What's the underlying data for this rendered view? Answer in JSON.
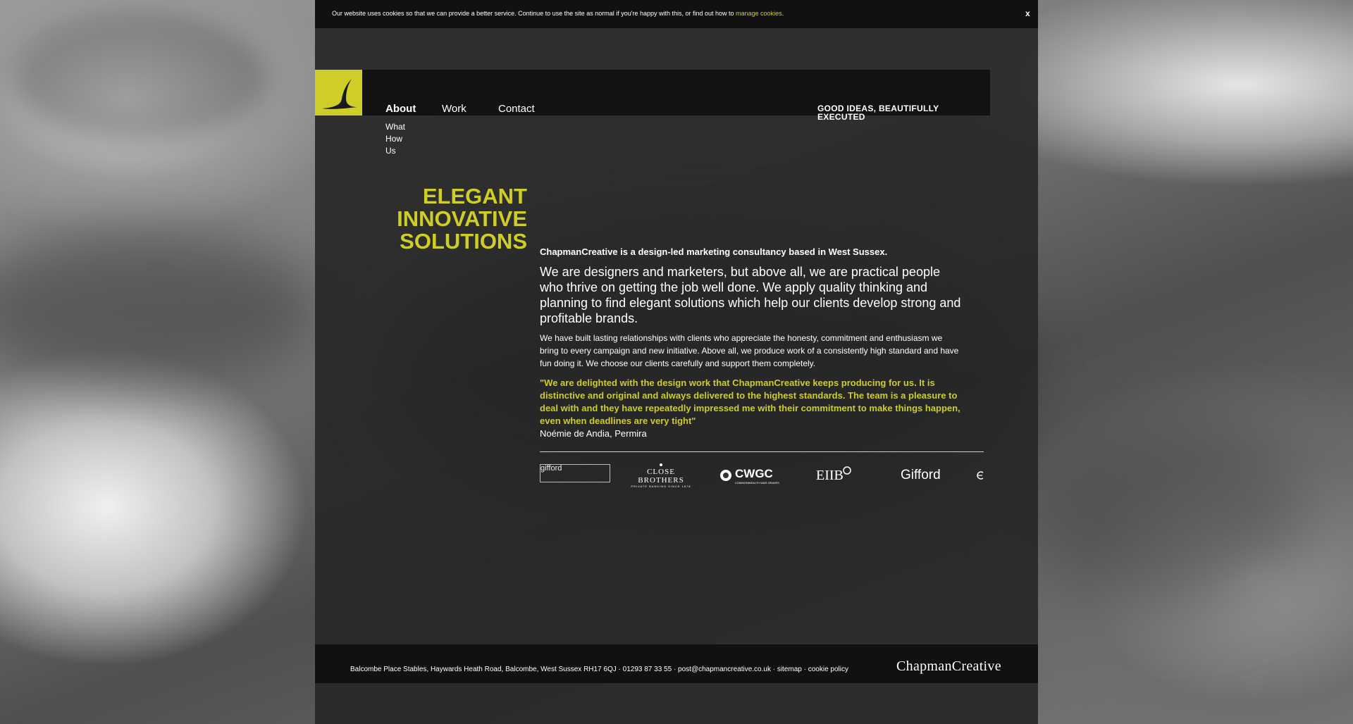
{
  "cookie_bar": {
    "message": "Our website uses cookies so that we can provide a better service. Continue to use the site as normal if you're happy with this, or find out how to ",
    "link_label": "manage cookies",
    "close_label": "x"
  },
  "header": {
    "nav": [
      {
        "label": "About",
        "active": true
      },
      {
        "label": "Work"
      },
      {
        "label": "Contact"
      }
    ],
    "subnav": [
      {
        "label": "What"
      },
      {
        "label": "How"
      },
      {
        "label": "Us"
      }
    ],
    "tagline": "GOOD IDEAS, BEAUTIFULLY EXECUTED",
    "logo_icon": "swoosh-logo-icon"
  },
  "hero": {
    "line1": "ELEGANT",
    "line2": "INNOVATIVE",
    "line3": "SOLUTIONS"
  },
  "content": {
    "intro": "ChapmanCreative is a design-led marketing consultancy based in West Sussex.",
    "lead": "We are designers and marketers, but above all, we are practical people who thrive on getting the job well done. We apply quality thinking and planning to find elegant solutions which help our clients develop strong and profitable brands.",
    "body": "We have built lasting relationships with clients who appreciate the honesty, commitment and enthusiasm we bring to every campaign and new initiative. Above all, we produce work of a consistently high standard and have fun doing it. We choose our clients carefully and support them completely.",
    "quote": "\"We are delighted with the design work that ChapmanCreative keeps producing for us. It is distinctive and original and always delivered to the highest standards. The team is a pleasure to deal with and they have repeatedly impressed me with their commitment to make things happen, even when deadlines are very tight\"",
    "quote_author": "Noémie de Andia, Permira"
  },
  "client_logos": {
    "broken_alt": "gifford",
    "close_brothers": "CLOSE BROTHERS",
    "close_brothers_sub": "PRIVATE BANKING SINCE 1878",
    "cwgc": "CWGC",
    "cwgc_sub": "COMMONWEALTH WAR GRAVES",
    "eiib": "EIIB",
    "gifford": "Gifford"
  },
  "footer": {
    "address": "Balcombe Place Stables, Haywards Heath Road, Balcombe, West Sussex RH17 6QJ · 01293 87 33 55 · post@chapmancreative.co.uk · sitemap · cookie policy",
    "brand": "ChapmanCreative"
  },
  "colors": {
    "accent": "#cfcd28",
    "panel": "#282828",
    "bar": "#111111"
  }
}
